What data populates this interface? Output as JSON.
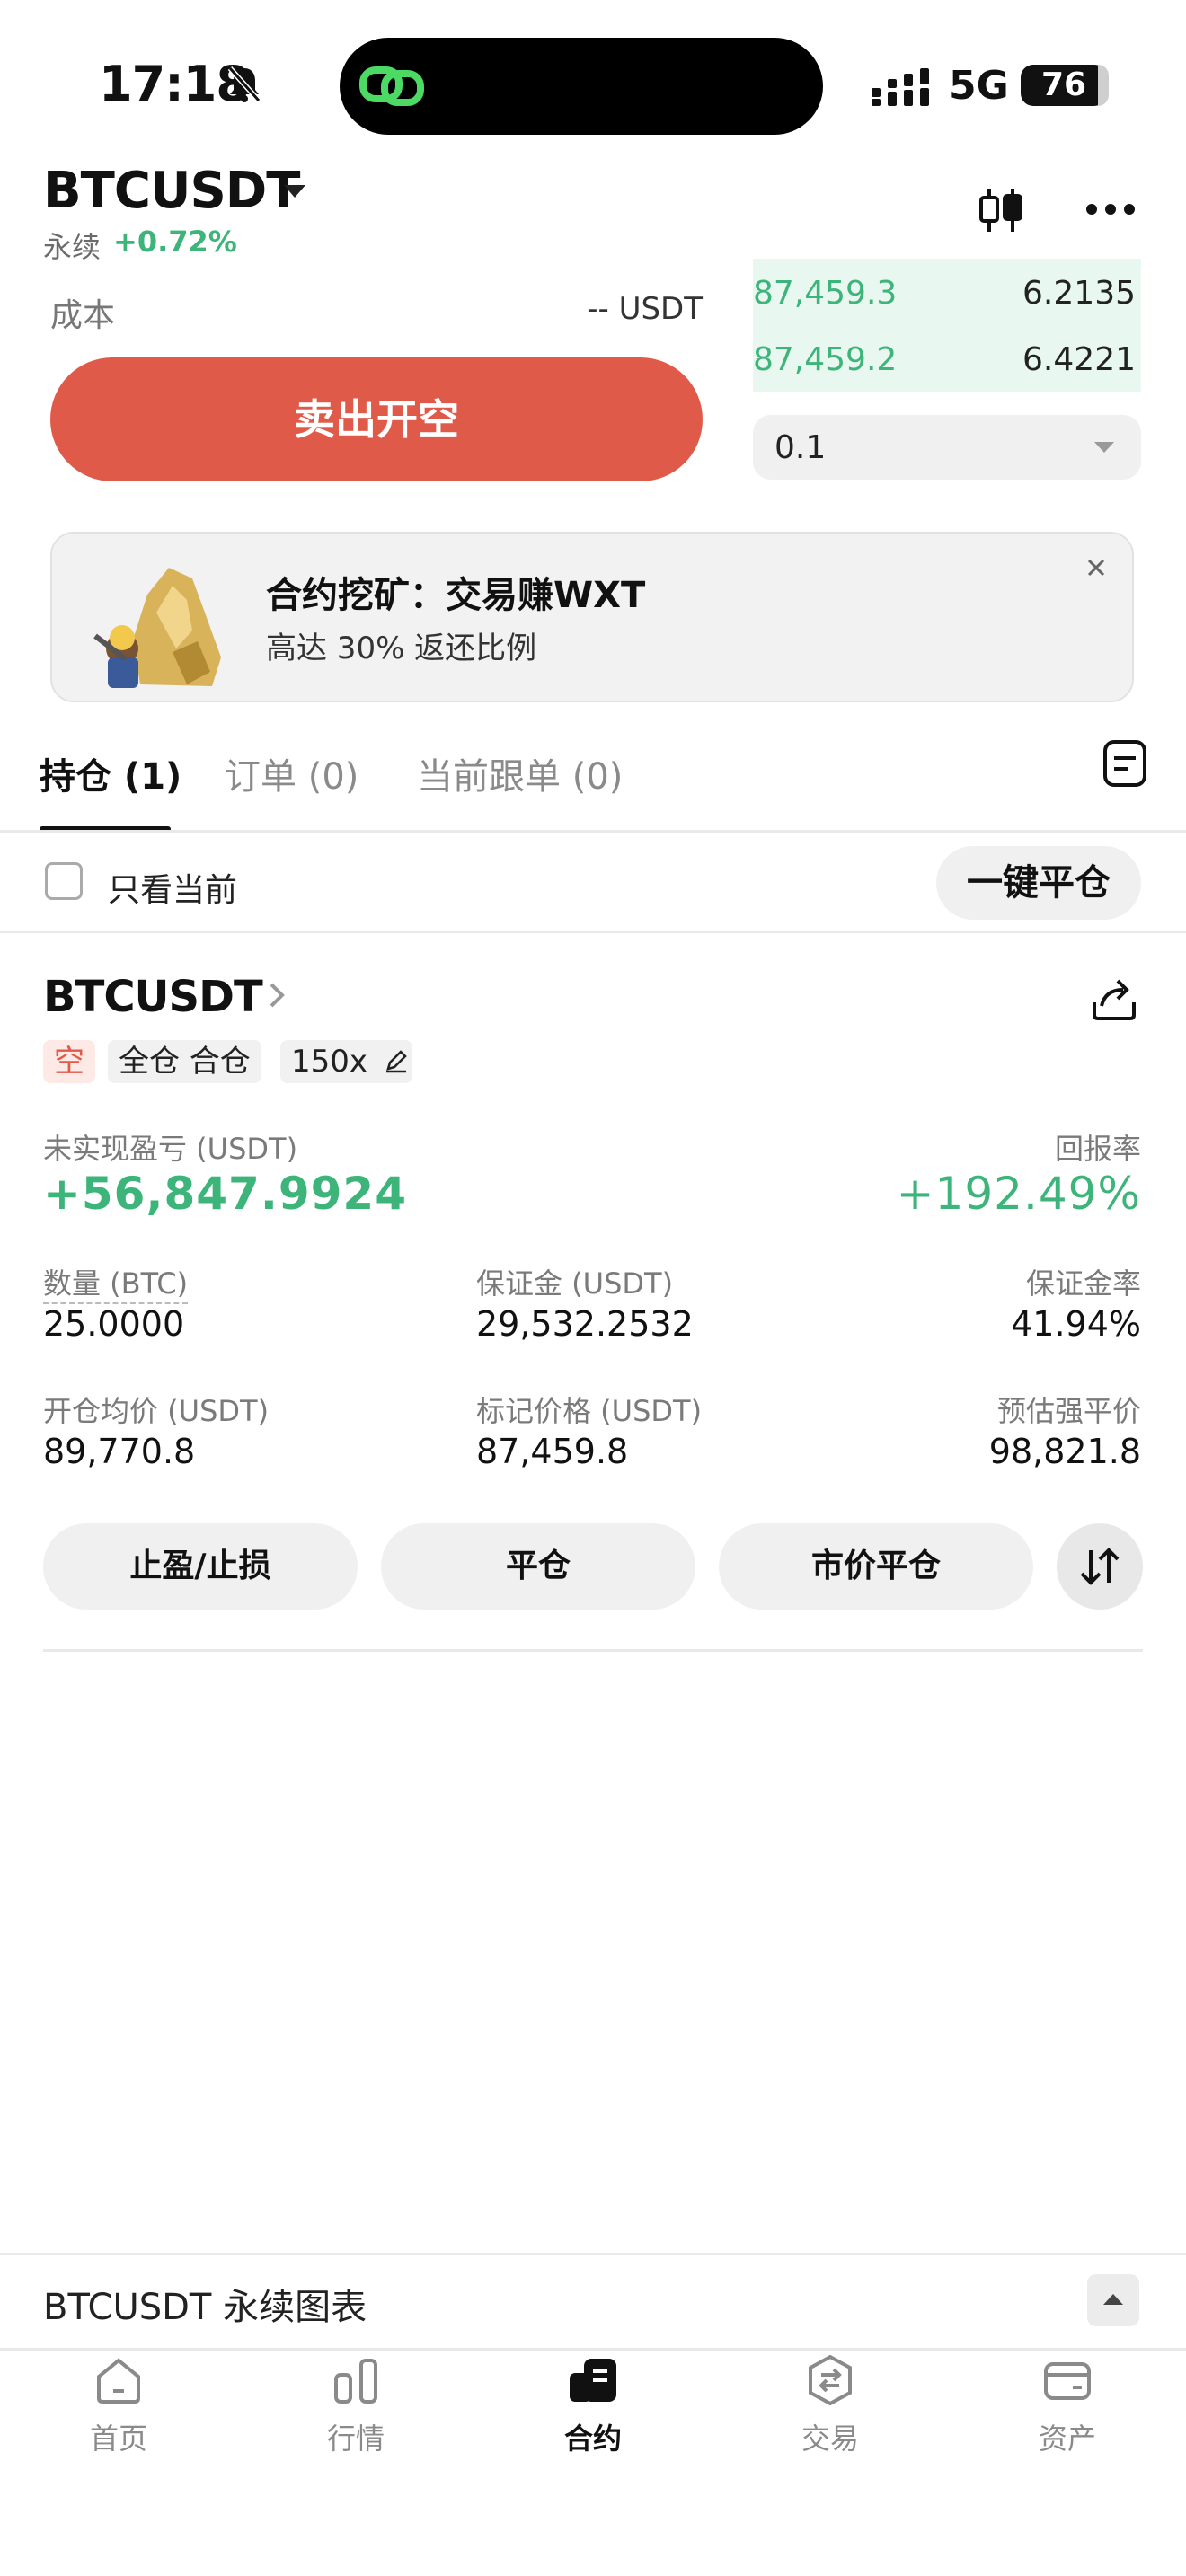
{
  "status_bar": {
    "time": "17:18",
    "network": "5G",
    "battery": "76"
  },
  "header": {
    "symbol": "BTCUSDT",
    "perp_label": "永续",
    "change": "+0.72%"
  },
  "order_panel": {
    "cost_label": "成本",
    "cost_value": "-- USDT",
    "sell_button": "卖出开空",
    "quantity_select": "0.1"
  },
  "order_book": {
    "asks": [
      {
        "price": "87,459.3",
        "qty": "6.2135"
      },
      {
        "price": "87,459.2",
        "qty": "6.4221"
      }
    ]
  },
  "banner": {
    "title": "合约挖矿：交易赚WXT",
    "subtitle": "高达 30% 返还比例"
  },
  "tabs": [
    {
      "label": "持仓 (1)"
    },
    {
      "label": "订单 (0)"
    },
    {
      "label": "当前跟单 (0)"
    }
  ],
  "filter": {
    "only_current": "只看当前",
    "close_all": "一键平仓"
  },
  "position": {
    "symbol": "BTCUSDT",
    "tags": {
      "side": "空",
      "mode": "全仓 合仓",
      "leverage": "150x"
    },
    "pnl_label": "未实现盈亏 (USDT)",
    "pnl_value": "+56,847.9924",
    "roe_label": "回报率",
    "roe_value": "+192.49%",
    "stats": [
      {
        "label": "数量 (BTC)",
        "value": "25.0000"
      },
      {
        "label": "保证金 (USDT)",
        "value": "29,532.2532"
      },
      {
        "label": "保证金率",
        "value": "41.94%"
      },
      {
        "label": "开仓均价 (USDT)",
        "value": "89,770.8"
      },
      {
        "label": "标记价格 (USDT)",
        "value": "87,459.8"
      },
      {
        "label": "预估强平价",
        "value": "98,821.8"
      }
    ],
    "actions": {
      "tpsl": "止盈/止损",
      "close": "平仓",
      "market_close": "市价平仓"
    }
  },
  "chart_bar": {
    "label": "BTCUSDT 永续图表"
  },
  "nav": [
    {
      "label": "首页",
      "icon": "home-icon"
    },
    {
      "label": "行情",
      "icon": "market-icon"
    },
    {
      "label": "合约",
      "icon": "futures-icon"
    },
    {
      "label": "交易",
      "icon": "trade-icon"
    },
    {
      "label": "资产",
      "icon": "wallet-icon"
    }
  ],
  "colors": {
    "green": "#3cb47a",
    "red": "#e05a4a"
  }
}
